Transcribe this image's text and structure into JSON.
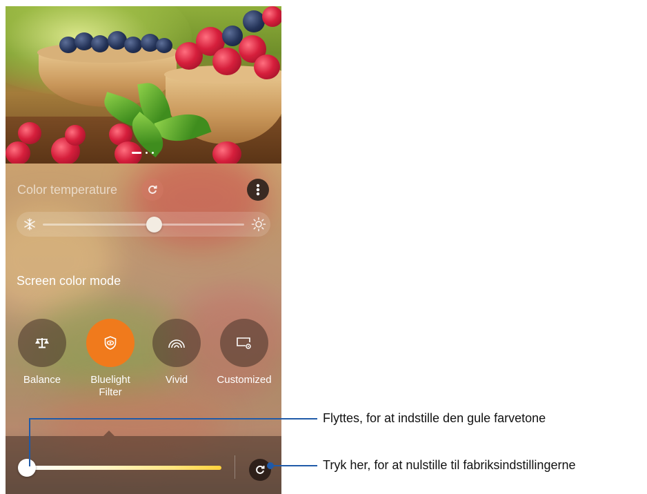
{
  "color_temperature": {
    "title": "Color temperature",
    "reset_icon": "refresh-icon",
    "menu_icon": "more-vertical-icon",
    "slider": {
      "min_icon": "snowflake-icon",
      "max_icon": "sun-icon",
      "value_fraction": 0.5
    }
  },
  "screen_color_mode": {
    "title": "Screen color mode",
    "selected": "bluelight-filter",
    "modes": [
      {
        "id": "balance",
        "label": "Balance",
        "icon": "balance-scale-icon"
      },
      {
        "id": "bluelight-filter",
        "label": "Bluelight\nFilter",
        "icon": "eye-shield-icon"
      },
      {
        "id": "vivid",
        "label": "Vivid",
        "icon": "rainbow-icon"
      },
      {
        "id": "customized",
        "label": "Customized",
        "icon": "screen-settings-icon"
      }
    ]
  },
  "bluelight_slider": {
    "value_fraction": 0.0,
    "reset_icon": "refresh-icon"
  },
  "wallpaper": {
    "page_indicator": {
      "count": 3,
      "active": 0
    }
  },
  "callouts": {
    "slider": "Flyttes, for at indstille den gule farvetone",
    "reset": "Tryk her, for at nulstille til fabriksindstillingerne"
  },
  "colors": {
    "accent_orange": "#f07a1c",
    "callout_blue": "#1f5aa8"
  }
}
